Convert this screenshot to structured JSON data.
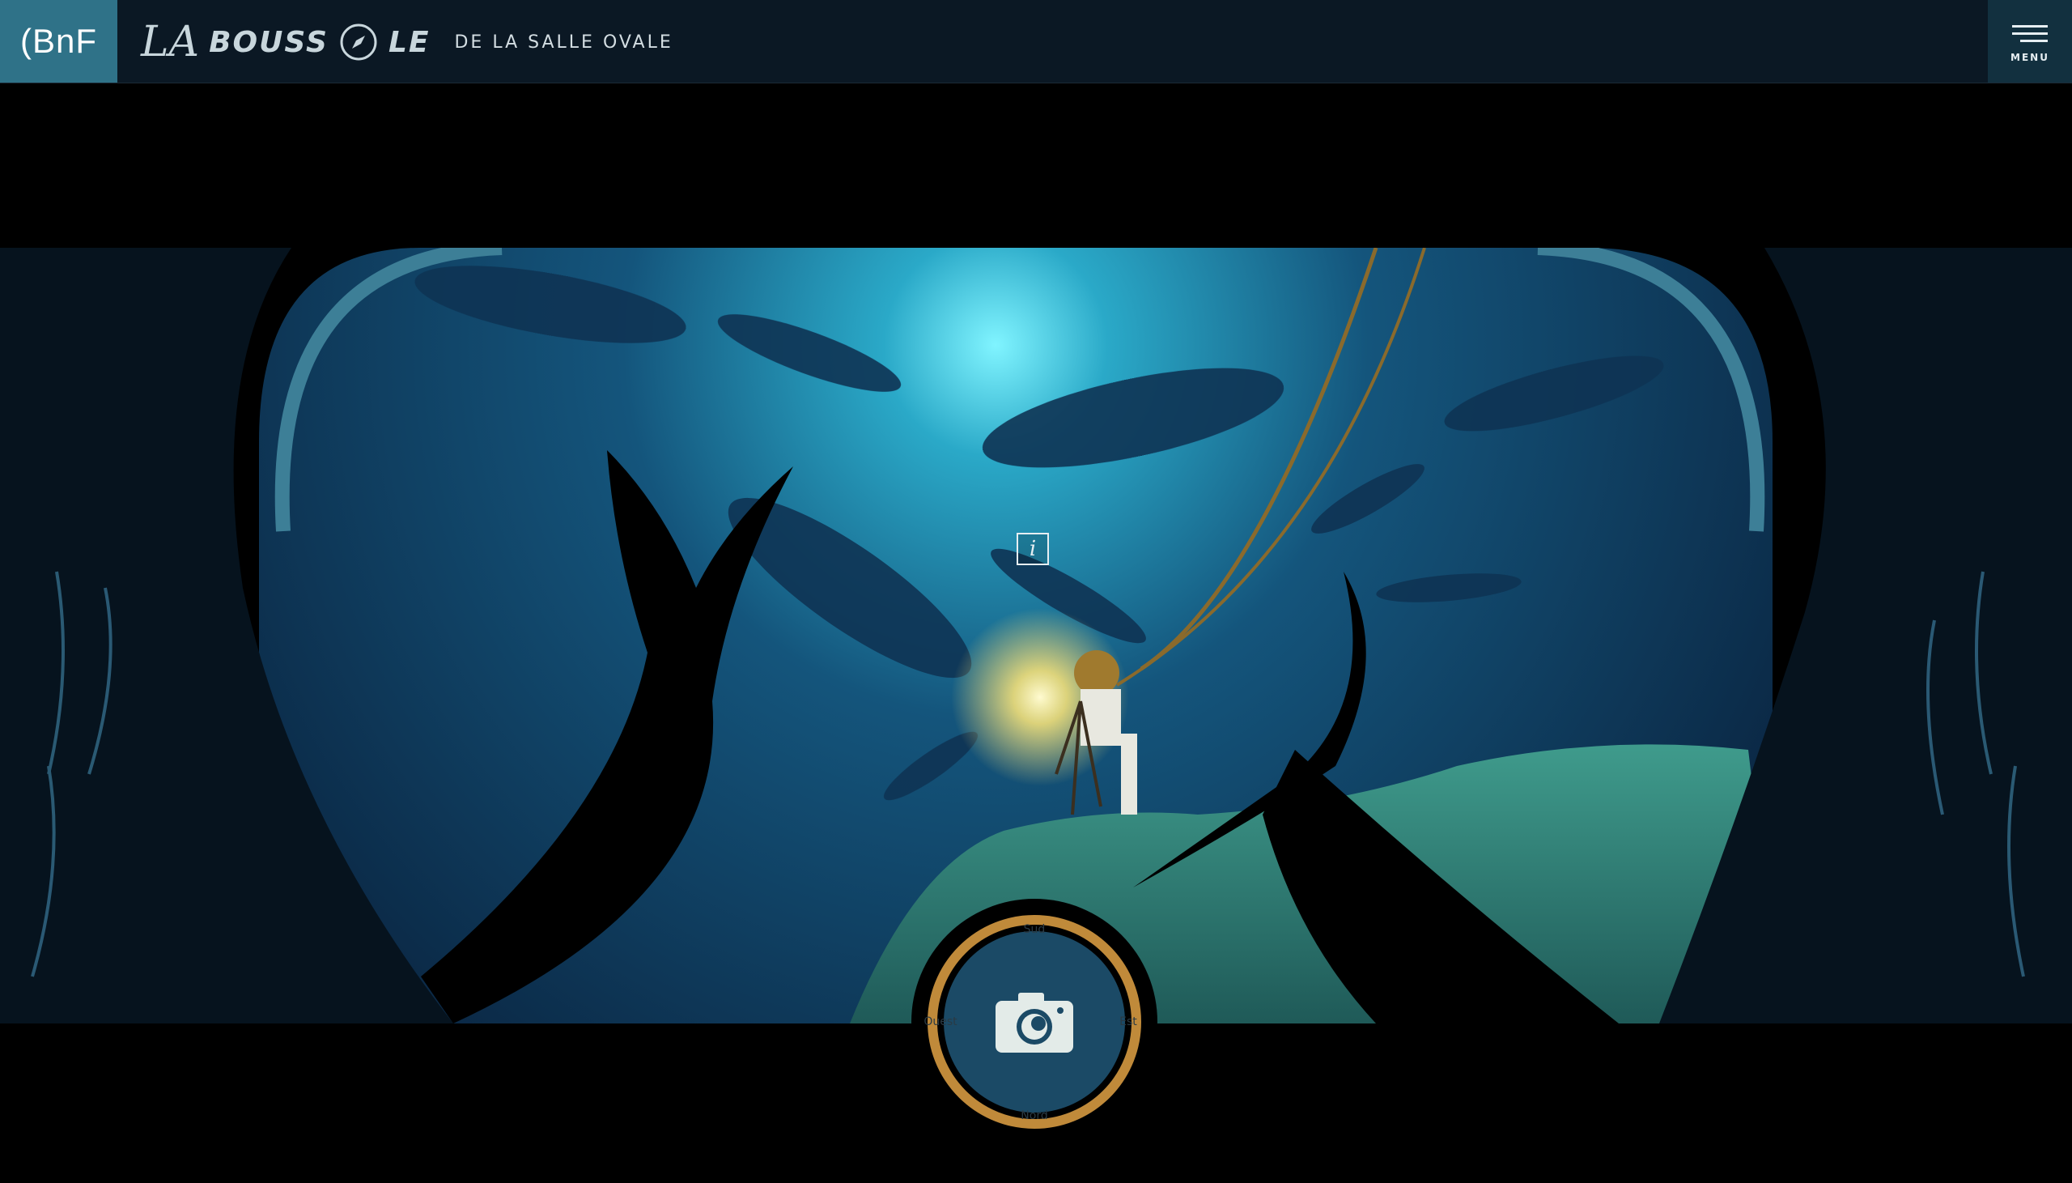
{
  "header": {
    "logo_text": "(BnF",
    "brand_la": "LA",
    "brand_word_1": "BOUSS",
    "brand_word_2": "LE",
    "brand_subtitle": "DE LA SALLE OVALE",
    "menu_label": "MENU"
  },
  "scene": {
    "info_label": "i",
    "camera_ring_text": [
      "Sud",
      "Est",
      "Nord",
      "Ouest"
    ]
  },
  "colors": {
    "topbar": "#0b1824",
    "bnf_blue": "#2f7288",
    "ocean_light": "#7af0ff",
    "ocean_dark": "#0b2a48",
    "ring_gold": "#c08a3a"
  }
}
